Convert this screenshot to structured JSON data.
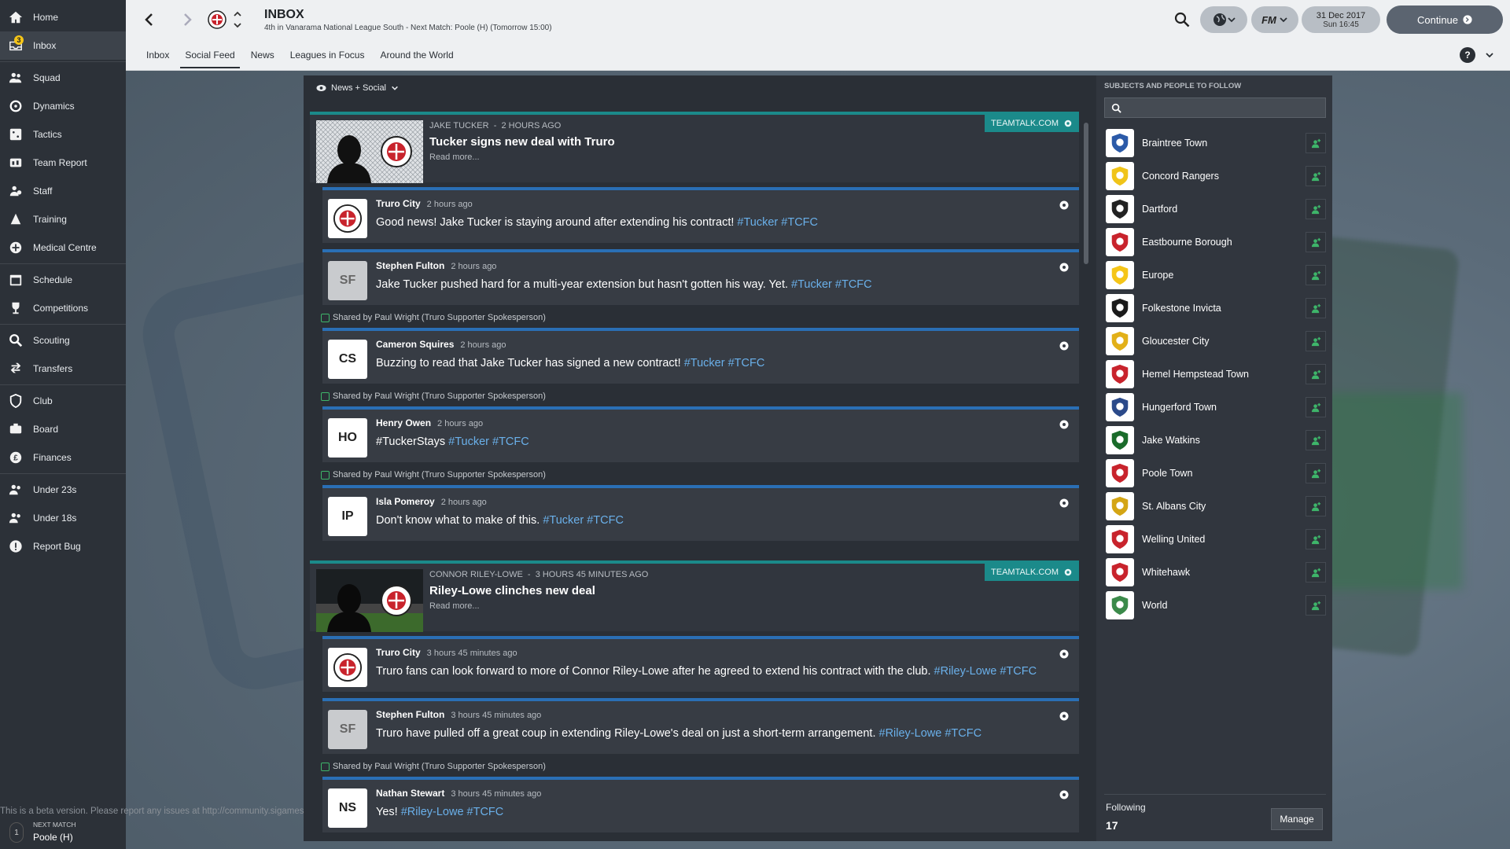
{
  "sidebar": {
    "items": [
      {
        "label": "Home",
        "icon": "home-icon"
      },
      {
        "label": "Inbox",
        "icon": "inbox-icon",
        "badge": "3",
        "active": true
      },
      {
        "label": "Squad",
        "icon": "squad-icon"
      },
      {
        "label": "Dynamics",
        "icon": "dynamics-icon"
      },
      {
        "label": "Tactics",
        "icon": "tactics-icon"
      },
      {
        "label": "Team Report",
        "icon": "team-report-icon"
      },
      {
        "label": "Staff",
        "icon": "staff-icon"
      },
      {
        "label": "Training",
        "icon": "training-icon"
      },
      {
        "label": "Medical Centre",
        "icon": "medical-icon"
      },
      {
        "label": "Schedule",
        "icon": "schedule-icon"
      },
      {
        "label": "Competitions",
        "icon": "trophy-icon"
      },
      {
        "label": "Scouting",
        "icon": "scouting-icon"
      },
      {
        "label": "Transfers",
        "icon": "transfers-icon"
      },
      {
        "label": "Club",
        "icon": "club-icon"
      },
      {
        "label": "Board",
        "icon": "board-icon"
      },
      {
        "label": "Finances",
        "icon": "finances-icon"
      },
      {
        "label": "Under 23s",
        "icon": "under23-icon"
      },
      {
        "label": "Under 18s",
        "icon": "under18-icon"
      },
      {
        "label": "Report Bug",
        "icon": "report-bug-icon"
      }
    ],
    "beta_notice": "This is a beta version. Please report any issues at http://community.sigames",
    "next_match_label": "NEXT MATCH",
    "next_match_value": "Poole (H)",
    "next_match_num": "1"
  },
  "header": {
    "title": "INBOX",
    "subtitle": "4th in Vanarama National League South - Next Match: Poole (H) (Tomorrow 15:00)",
    "date": "31 Dec 2017",
    "time": "Sun 16:45",
    "fm_label": "FM",
    "continue_label": "Continue"
  },
  "tabs": [
    "Inbox",
    "Social Feed",
    "News",
    "Leagues in Focus",
    "Around the World"
  ],
  "active_tab": "Social Feed",
  "feed": {
    "filter_label": "News + Social",
    "articles": [
      {
        "author": "JAKE TUCKER",
        "age": "2 HOURS AGO",
        "headline": "Tucker signs new deal with Truro",
        "read_more": "Read more...",
        "source": "TEAMTALK.COM"
      },
      {
        "author": "CONNOR RILEY-LOWE",
        "age": "3 HOURS 45 MINUTES AGO",
        "headline": "Riley-Lowe clinches new deal",
        "read_more": "Read more...",
        "source": "TEAMTALK.COM"
      }
    ],
    "posts": [
      {
        "name": "Truro City",
        "time": "2 hours ago",
        "text": "Good news! Jake Tucker is staying around after extending his contract!",
        "tags": "#Tucker #TCFC",
        "avatar": "crest"
      },
      {
        "name": "Stephen Fulton",
        "time": "2 hours ago",
        "text": "Jake Tucker pushed hard for a multi-year extension but hasn't gotten his way. Yet.",
        "tags": "#Tucker #TCFC",
        "avatar": "SF"
      },
      {
        "name": "Cameron Squires",
        "time": "2 hours ago",
        "text": "Buzzing to read that Jake Tucker has signed a new contract!",
        "tags": "#Tucker #TCFC",
        "avatar": "CS"
      },
      {
        "name": "Henry Owen",
        "time": "2 hours ago",
        "text": "#TuckerStays",
        "tags": "#Tucker #TCFC",
        "avatar": "HO"
      },
      {
        "name": "Isla Pomeroy",
        "time": "2 hours ago",
        "text": "Don't know what to make of this.",
        "tags": "#Tucker #TCFC",
        "avatar": "IP"
      },
      {
        "name": "Truro City",
        "time": "3 hours 45 minutes ago",
        "text": "Truro fans can look forward to more of Connor Riley-Lowe after he agreed to extend his contract with the club.",
        "tags": "#Riley-Lowe #TCFC",
        "avatar": "crest"
      },
      {
        "name": "Stephen Fulton",
        "time": "3 hours 45 minutes ago",
        "text": "Truro have pulled off a great coup in extending Riley-Lowe's deal on just a short-term arrangement.",
        "tags": "#Riley-Lowe #TCFC",
        "avatar": "SF"
      },
      {
        "name": "Nathan Stewart",
        "time": "3 hours 45 minutes ago",
        "text": "Yes!",
        "tags": "#Riley-Lowe #TCFC",
        "avatar": "NS"
      }
    ],
    "shared_text": "Shared by Paul Wright (Truro Supporter Spokesperson)"
  },
  "follow_panel": {
    "title": "SUBJECTS AND PEOPLE TO FOLLOW",
    "search_placeholder": "",
    "items": [
      "Braintree Town",
      "Concord Rangers",
      "Dartford",
      "Eastbourne Borough",
      "Europe",
      "Folkestone Invicta",
      "Gloucester City",
      "Hemel Hempstead Town",
      "Hungerford Town",
      "Jake Watkins",
      "Poole Town",
      "St. Albans City",
      "Welling United",
      "Whitehawk",
      "World"
    ],
    "following_label": "Following",
    "following_count": "17",
    "manage_label": "Manage"
  },
  "colors": {
    "accent_teal": "#1b8a8a",
    "post_border": "#2a6fb5",
    "hashtag": "#6ab0ea",
    "shared_icon": "#3eb56a"
  }
}
